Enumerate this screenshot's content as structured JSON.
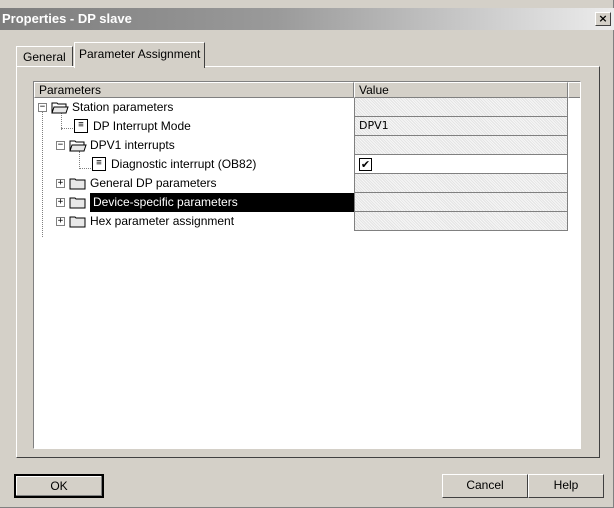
{
  "window": {
    "title": "Properties - DP slave",
    "close_label": "×"
  },
  "tabs": [
    {
      "label": "General"
    },
    {
      "label": "Parameter Assignment"
    }
  ],
  "grid": {
    "headers": {
      "parameters": "Parameters",
      "value": "Value"
    },
    "rows": [
      {
        "label": "Station parameters",
        "icon": "folder-open-icon",
        "expanded": true,
        "value": ""
      },
      {
        "label": "DP Interrupt Mode",
        "icon": "document-icon",
        "value": "DPV1"
      },
      {
        "label": "DPV1 interrupts",
        "icon": "folder-open-icon",
        "expanded": true,
        "value": ""
      },
      {
        "label": "Diagnostic interrupt (OB82)",
        "icon": "document-icon",
        "value_checked": true,
        "value": "✔"
      },
      {
        "label": "General DP parameters",
        "icon": "folder-icon",
        "expanded": false,
        "value": ""
      },
      {
        "label": "Device-specific parameters",
        "icon": "folder-icon",
        "expanded": false,
        "selected": true,
        "value": ""
      },
      {
        "label": "Hex parameter assignment",
        "icon": "folder-icon",
        "expanded": false,
        "value": ""
      }
    ],
    "expander_minus": "−",
    "expander_plus": "+",
    "doc_glyph": "≡"
  },
  "buttons": {
    "ok": "OK",
    "cancel": "Cancel",
    "help": "Help"
  },
  "colors": {
    "selection_bg": "#000000",
    "face": "#d4d0c8"
  }
}
